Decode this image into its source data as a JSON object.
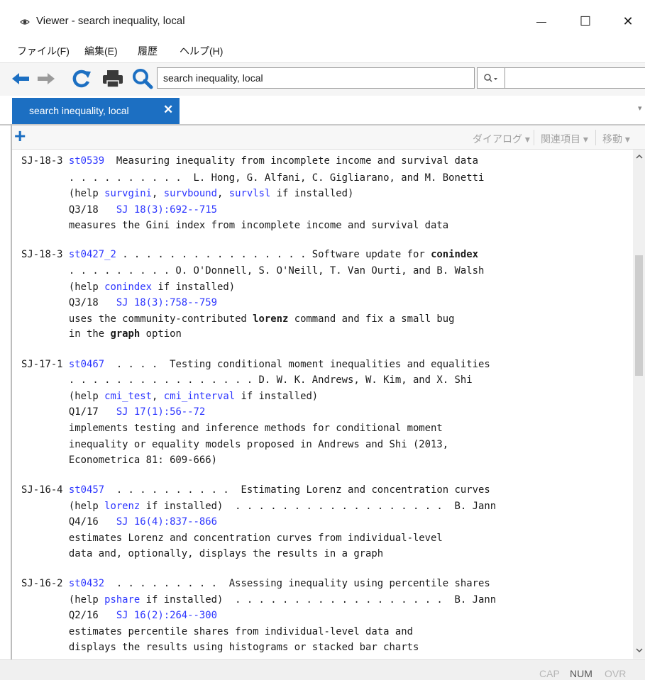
{
  "window": {
    "title": "Viewer - search inequality, local",
    "minimize_glyph": "—",
    "maximize_glyph": "☐",
    "close_glyph": "✕"
  },
  "menu": {
    "file": "ファイル(F)",
    "edit": "編集(E)",
    "history": "履歴",
    "help": "ヘルプ(H)"
  },
  "toolbar": {
    "url_value": "search inequality, local",
    "find_value": "",
    "icons": [
      "back-arrow-icon",
      "forward-arrow-icon",
      "refresh-icon",
      "print-icon",
      "search-icon"
    ],
    "accent_color": "#1c6fc2"
  },
  "tabs": [
    {
      "label": "search inequality, local",
      "close": "✕"
    }
  ],
  "tabstrip_menu_glyph": "▾",
  "subbar": {
    "add_glyph": "+",
    "dialog": "ダイアログ ▾",
    "related": "関連項目 ▾",
    "move": "移動 ▾"
  },
  "entries": [
    {
      "id": "SJ-18-3",
      "pkg": "st0539",
      "title_line": "  Measuring inequality from incomplete income and survival data",
      "author_line": "        . . . . . . . . . .  L. Hong, G. Alfani, C. Gigliarano, and M. Bonetti",
      "help_pre": "        (help ",
      "help_links": [
        "survgini",
        "survbound",
        "survlsl"
      ],
      "help_post": " if installed)",
      "issue": "        Q3/18   ",
      "ref": "SJ 18(3):692--715",
      "desc": [
        "        measures the Gini index from incomplete income and survival data"
      ]
    },
    {
      "id": "SJ-18-3",
      "pkg": "st0427_2",
      "title_line": " . . . . . . . . . . . . . . . . Software update for ",
      "title_bold": "conindex",
      "author_line": "        . . . . . . . . . O. O'Donnell, S. O'Neill, T. Van Ourti, and B. Walsh",
      "help_pre": "        (help ",
      "help_links": [
        "conindex"
      ],
      "help_post": " if installed)",
      "issue": "        Q3/18   ",
      "ref": "SJ 18(3):758--759",
      "desc_line1_pre": "        uses the community-contributed ",
      "desc_line1_bold": "lorenz",
      "desc_line1_post": " command and fix a small bug",
      "desc_line2_pre": "        in the ",
      "desc_line2_bold": "graph",
      "desc_line2_post": " option"
    },
    {
      "id": "SJ-17-1",
      "pkg": "st0467",
      "title_line": "  . . . .  Testing conditional moment inequalities and equalities",
      "author_line": "        . . . . . . . . . . . . . . . . D. W. K. Andrews, W. Kim, and X. Shi",
      "help_pre": "        (help ",
      "help_links": [
        "cmi_test",
        "cmi_interval"
      ],
      "help_post": " if installed)",
      "issue": "        Q1/17   ",
      "ref": "SJ 17(1):56--72",
      "desc": [
        "        implements testing and inference methods for conditional moment",
        "        inequality or equality models proposed in Andrews and Shi (2013,",
        "        Econometrica 81: 609-666)"
      ]
    },
    {
      "id": "SJ-16-4",
      "pkg": "st0457",
      "title_line": "  . . . . . . . . . .  Estimating Lorenz and concentration curves",
      "help_pre": "        (help ",
      "help_links": [
        "lorenz"
      ],
      "help_post": " if installed)  . . . . . . . . . . . . . . . . . .  B. Jann",
      "issue": "        Q4/16   ",
      "ref": "SJ 16(4):837--866",
      "desc": [
        "        estimates Lorenz and concentration curves from individual-level",
        "        data and, optionally, displays the results in a graph"
      ]
    },
    {
      "id": "SJ-16-2",
      "pkg": "st0432",
      "title_line": "  . . . . . . . . .  Assessing inequality using percentile shares",
      "help_pre": "        (help ",
      "help_links": [
        "pshare"
      ],
      "help_post": " if installed)  . . . . . . . . . . . . . . . . . .  B. Jann",
      "issue": "        Q2/16   ",
      "ref": "SJ 16(2):264--300",
      "desc": [
        "        estimates percentile shares from individual-level data and",
        "        displays the results using histograms or stacked bar charts"
      ]
    }
  ],
  "status": {
    "cap": "CAP",
    "num": "NUM",
    "ovr": "OVR",
    "active_color": "#555555",
    "inactive_color": "#b5b5b5"
  }
}
